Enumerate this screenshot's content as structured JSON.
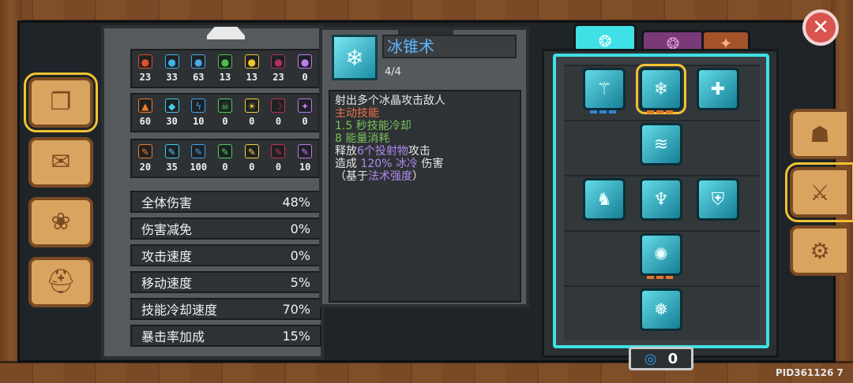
{
  "stats_grid": [
    [
      {
        "icon": "fire-icon",
        "glyph": "●",
        "color": "#e2502a",
        "value": "23"
      },
      {
        "icon": "ice-icon",
        "glyph": "●",
        "color": "#3ab3e8",
        "value": "33"
      },
      {
        "icon": "lightning-icon",
        "glyph": "●",
        "color": "#4aa7e8",
        "value": "63"
      },
      {
        "icon": "poison-icon",
        "glyph": "●",
        "color": "#4ec04a",
        "value": "13"
      },
      {
        "icon": "light-icon",
        "glyph": "●",
        "color": "#f1c232",
        "value": "13"
      },
      {
        "icon": "dark-icon",
        "glyph": "●",
        "color": "#b0305a",
        "value": "23"
      },
      {
        "icon": "arcane-icon",
        "glyph": "●",
        "color": "#c07df0",
        "value": "0"
      }
    ],
    [
      {
        "icon": "fire-icon",
        "glyph": "▲",
        "color": "#ef7a2a",
        "value": "60"
      },
      {
        "icon": "ice-icon",
        "glyph": "◆",
        "color": "#45c9ef",
        "value": "30"
      },
      {
        "icon": "lightning-icon",
        "glyph": "ϟ",
        "color": "#3fa2ef",
        "value": "10"
      },
      {
        "icon": "poison-icon",
        "glyph": "☠",
        "color": "#4bd15a",
        "value": "0"
      },
      {
        "icon": "light-icon",
        "glyph": "☀",
        "color": "#f5d23b",
        "value": "0"
      },
      {
        "icon": "dark-icon",
        "glyph": "☽",
        "color": "#c2304f",
        "value": "0"
      },
      {
        "icon": "arcane-icon",
        "glyph": "✦",
        "color": "#c277f5",
        "value": "0"
      }
    ],
    [
      {
        "icon": "fire-icon",
        "glyph": "✎",
        "color": "#ef7a2a",
        "value": "20"
      },
      {
        "icon": "ice-icon",
        "glyph": "✎",
        "color": "#45c9ef",
        "value": "35"
      },
      {
        "icon": "lightning-icon",
        "glyph": "✎",
        "color": "#3fa2ef",
        "value": "100"
      },
      {
        "icon": "poison-icon",
        "glyph": "✎",
        "color": "#4bd15a",
        "value": "0"
      },
      {
        "icon": "light-icon",
        "glyph": "✎",
        "color": "#f5d23b",
        "value": "0"
      },
      {
        "icon": "dark-icon",
        "glyph": "✎",
        "color": "#c2304f",
        "value": "0"
      },
      {
        "icon": "arcane-icon",
        "glyph": "✎",
        "color": "#c277f5",
        "value": "10"
      }
    ]
  ],
  "attributes": [
    {
      "label": "全体伤害",
      "value": "48%"
    },
    {
      "label": "伤害减免",
      "value": "0%"
    },
    {
      "label": "攻击速度",
      "value": "0%"
    },
    {
      "label": "移动速度",
      "value": "5%"
    },
    {
      "label": "技能冷却速度",
      "value": "70%"
    },
    {
      "label": "暴击率加成",
      "value": "15%"
    }
  ],
  "skill": {
    "name": "冰锥术",
    "level": "4/4",
    "desc_line1": "射出多个冰晶攻击敌人",
    "type_label": "主动技能",
    "cooldown": "1.5 秒技能冷却",
    "energy": "8 能量消耗",
    "line5_a": "释放",
    "line5_b": "6个投射物",
    "line5_c": "攻击",
    "line6_a": "造成",
    "line6_b": "120% 冰冷",
    "line6_c": "伤害",
    "line7_a": "（基于",
    "line7_b": "法术强度",
    "line7_c": "）"
  },
  "skill_points": "0",
  "pid": "PID361126  7",
  "close_glyph": "✕"
}
